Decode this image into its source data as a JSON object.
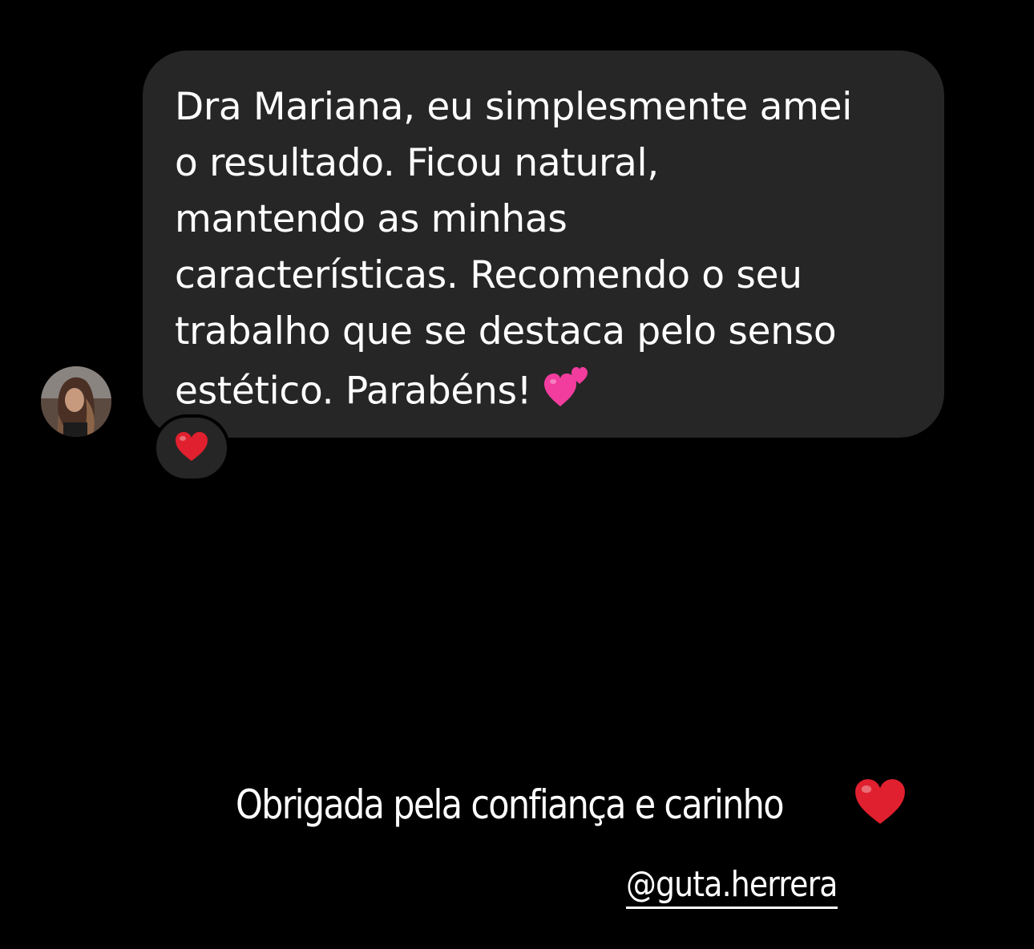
{
  "message": {
    "lines": [
      "Dra Mariana, eu simplesmente amei",
      "o resultado. Ficou natural,",
      "mantendo as minhas",
      "características. Recomendo o seu",
      "trabalho que se destaca pelo senso",
      "estético. Parabéns!"
    ],
    "emoji": "two-hearts-icon"
  },
  "reaction": {
    "emoji": "red-heart-icon"
  },
  "caption": {
    "text": "Obrigada pela confiança e carinho",
    "emoji": "red-heart-icon"
  },
  "mention": {
    "text": "@guta.herrera"
  },
  "colors": {
    "background": "#000000",
    "bubble": "#262626",
    "text": "#ffffff",
    "heart_red": "#e0202e",
    "heart_pink": "#f23d9e"
  }
}
